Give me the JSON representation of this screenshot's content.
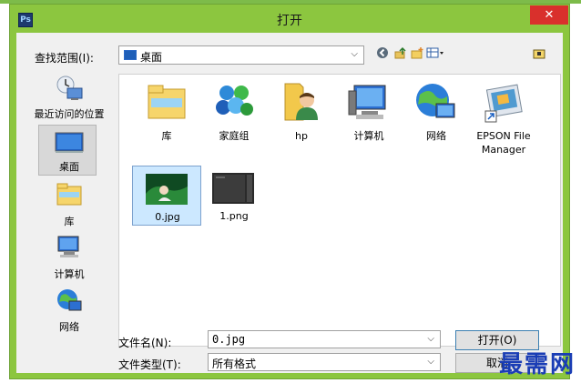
{
  "app_icon": "Ps",
  "title": "打开",
  "close_glyph": "✕",
  "lookin": {
    "label": "查找范围(I):",
    "value": "桌面"
  },
  "toolbar_icons": [
    "back-icon",
    "up-folder-icon",
    "new-folder-icon",
    "view-menu-icon"
  ],
  "places": [
    {
      "label": "最近访问的位置",
      "icon": "recent-places-icon"
    },
    {
      "label": "桌面",
      "icon": "desktop-icon",
      "active": true
    },
    {
      "label": "库",
      "icon": "library-icon"
    },
    {
      "label": "计算机",
      "icon": "computer-icon"
    },
    {
      "label": "网络",
      "icon": "network-icon"
    }
  ],
  "items": [
    {
      "label": "库",
      "icon": "library-icon"
    },
    {
      "label": "家庭组",
      "icon": "homegroup-icon"
    },
    {
      "label": "hp",
      "icon": "user-folder-icon"
    },
    {
      "label": "计算机",
      "icon": "computer-icon"
    },
    {
      "label": "网络",
      "icon": "network-icon"
    },
    {
      "label": "EPSON File Manager",
      "icon": "epson-shortcut-icon"
    },
    {
      "label": "0.jpg",
      "icon": "image-thumbnail",
      "selected": true
    },
    {
      "label": "1.png",
      "icon": "image-thumbnail"
    }
  ],
  "file_name": {
    "label": "文件名(N):",
    "value": "0.jpg"
  },
  "file_type": {
    "label": "文件类型(T):",
    "value": "所有格式"
  },
  "buttons": {
    "open": "打开(O)",
    "cancel": "取消"
  },
  "watermark": "最需网",
  "colors": {
    "frame": "#8cc63f",
    "close": "#d9302c",
    "selection": "#cce8ff",
    "watermark": "#1a3db5"
  }
}
